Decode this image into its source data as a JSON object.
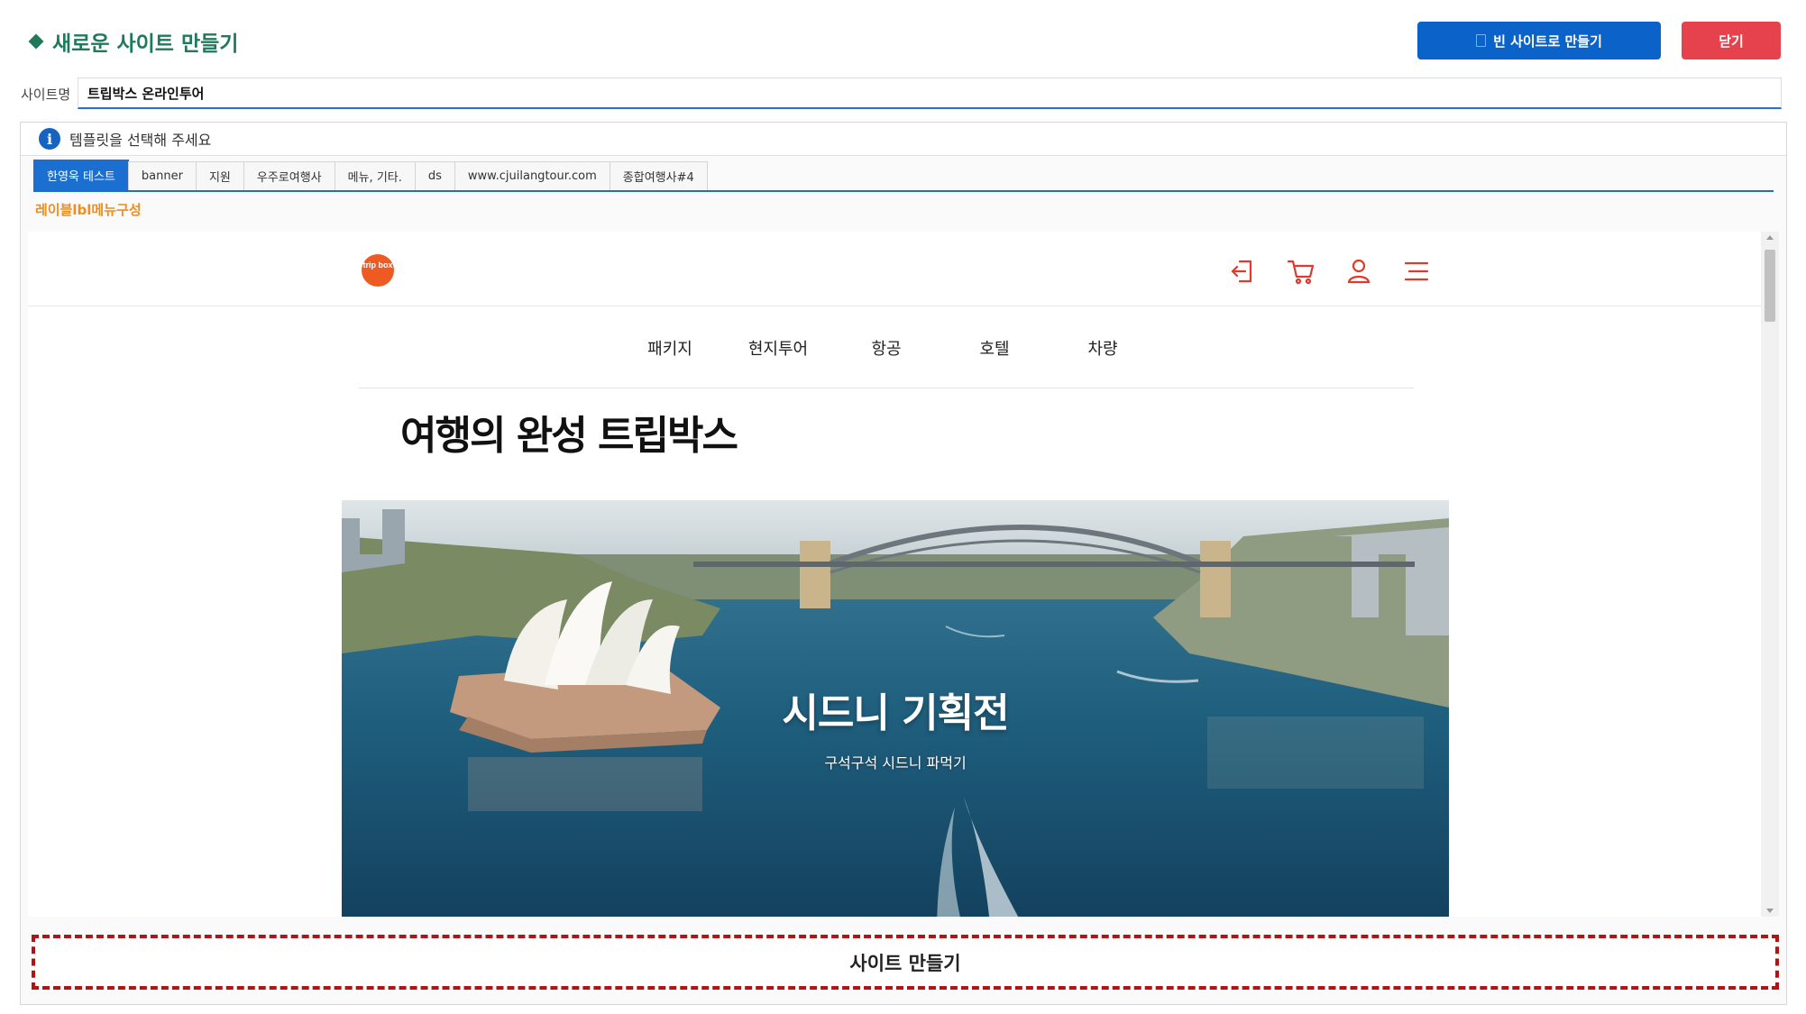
{
  "header": {
    "title": "새로운 사이트 만들기",
    "blank_button": "빈 사이트로 만들기",
    "close_button": "닫기"
  },
  "site_name": {
    "label": "사이트명",
    "value": "트립박스 온라인투어"
  },
  "template": {
    "info": "템플릿을 선택해 주세요",
    "tabs": [
      {
        "label": "한영욱 테스트",
        "active": true
      },
      {
        "label": "banner"
      },
      {
        "label": "지원"
      },
      {
        "label": "우주로여행사"
      },
      {
        "label": "메뉴, 기타."
      },
      {
        "label": "ds"
      },
      {
        "label": "www.cjuilangtour.com"
      },
      {
        "label": "종합여행사#4"
      }
    ],
    "subtitle": "레이블lbl메뉴구성"
  },
  "preview": {
    "logo_text": "trip box",
    "header_icons": [
      "login-icon",
      "cart-icon",
      "user-icon",
      "menu-icon"
    ],
    "accent_color": "#e03a2c",
    "nav": [
      "패키지",
      "현지투어",
      "항공",
      "호텔",
      "차량"
    ],
    "hero_title": "여행의 완성 트립박스",
    "banner": {
      "title": "시드니 기획전",
      "subtitle": "구석구석 시드니 파먹기"
    }
  },
  "actions": {
    "make_site": "사이트 만들기"
  },
  "colors": {
    "primary": "#0b63c9",
    "danger": "#e6424d",
    "title_green": "#1f7a5a",
    "subtitle_orange": "#f28c1c",
    "highlight_red": "#b01515"
  }
}
